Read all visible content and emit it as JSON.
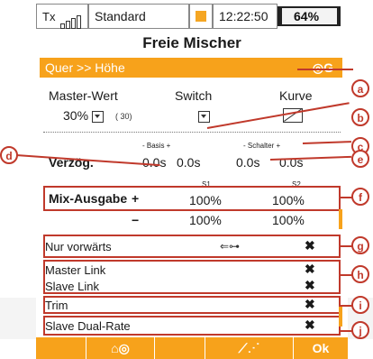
{
  "status": {
    "tx_label": "Tx",
    "model_name": "Standard",
    "time": "12:22:50",
    "battery": "64%"
  },
  "title": "Freie Mischer",
  "mixer_header": {
    "label": "Quer >> Höhe",
    "icon": "eye-g-icon"
  },
  "master": {
    "label": "Master-Wert",
    "value": "30%",
    "sub_value": "( 30)"
  },
  "switch": {
    "label": "Switch"
  },
  "curve": {
    "label": "Kurve"
  },
  "labels": {
    "basis": "- Basis +",
    "schalter": "- Schalter +",
    "s1": "S1",
    "s2": "S2"
  },
  "verzog": {
    "label": "Verzög.",
    "values": [
      "0.0s",
      "0.0s",
      "0.0s",
      "0.0s"
    ]
  },
  "mix_output": {
    "label": "Mix-Ausgabe",
    "plus": "+",
    "minus": "−",
    "plus_s1": "100%",
    "plus_s2": "100%",
    "minus_s1": "100%",
    "minus_s2": "100%"
  },
  "options": [
    {
      "label": "Nur vorwärts",
      "mark": "✖"
    },
    {
      "label": "Master Link",
      "mark": "✖"
    },
    {
      "label": "Slave Link",
      "mark": "✖"
    },
    {
      "label": "Trim",
      "mark": "✖"
    },
    {
      "label": "Slave Dual-Rate",
      "mark": "✖"
    }
  ],
  "callouts": [
    "a",
    "b",
    "c",
    "d",
    "e",
    "f",
    "g",
    "h",
    "i",
    "j"
  ],
  "bottom": {
    "ok_label": "Ok",
    "tab1_icon": "model-eye-icon",
    "tab3_icon": "curve-icon"
  },
  "colors": {
    "accent": "#f7a21b",
    "callout": "#c0392b"
  }
}
